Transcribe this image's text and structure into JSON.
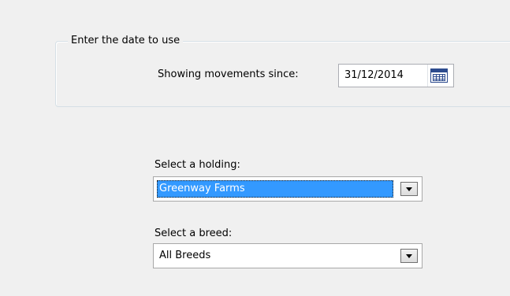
{
  "date_group": {
    "legend": "Enter the date to use",
    "label": "Showing movements since:",
    "value": "31/12/2014",
    "picker_icon": "calendar-icon"
  },
  "holding": {
    "label": "Select a holding:",
    "selected": "Greenway Farms",
    "dropdown_icon": "chevron-down-icon"
  },
  "breed": {
    "label": "Select a breed:",
    "selected": "All Breeds",
    "dropdown_icon": "chevron-down-icon"
  },
  "colors": {
    "selection": "#3399ff",
    "background": "#f0f0f0",
    "calendar": "#2d4b8e"
  }
}
